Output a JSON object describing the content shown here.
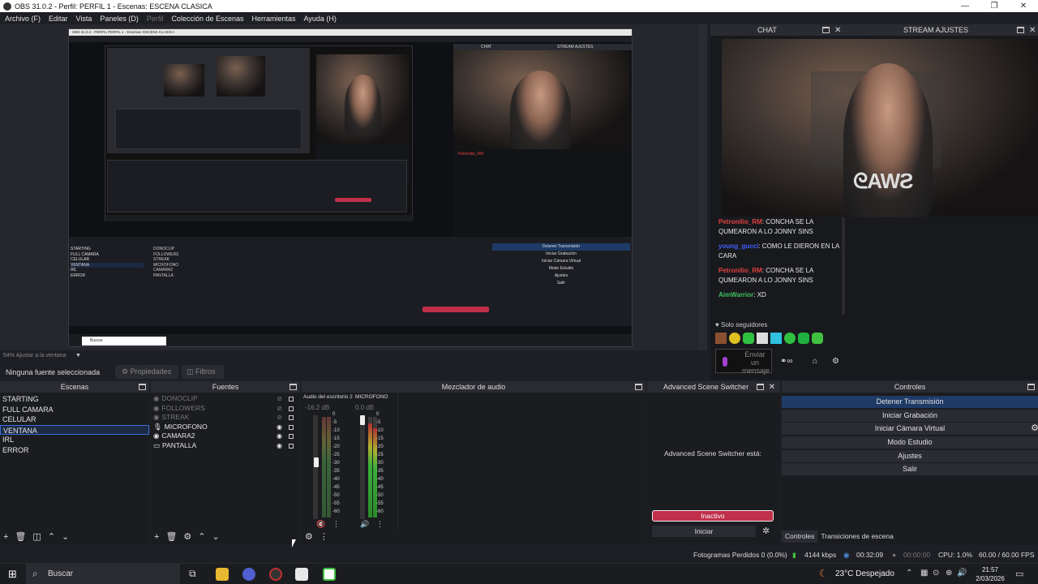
{
  "window": {
    "title": "OBS 31.0.2 - Perfil: PERFIL 1 - Escenas: ESCENA CLASICA",
    "controls": [
      "—",
      "❐",
      "✕"
    ]
  },
  "menu": [
    {
      "label": "Archivo (F)"
    },
    {
      "label": "Editar"
    },
    {
      "label": "Vista"
    },
    {
      "label": "Paneles (D)"
    },
    {
      "label": "Perfil",
      "disabled": true
    },
    {
      "label": "Colección de Escenas"
    },
    {
      "label": "Herramientas"
    },
    {
      "label": "Ayuda (H)"
    }
  ],
  "preview": {
    "zoom_label": "54% Ajustar a la ventana"
  },
  "nested_preview": {
    "title": "OBS 31.0.2 - PERFIL PERFIL 1 - Escenas: ESCENA CLASICA",
    "chat_label": "CHAT",
    "stream_label": "STREAM AJUSTES",
    "scenes": [
      "STARTING",
      "FULL CAMARA",
      "CELULAR",
      "VENTANA",
      "IRL",
      "ERROR"
    ],
    "sources": [
      "DONOCLIP",
      "FOLLOWERS",
      "STREAK",
      "MICROFONO",
      "CAMARA2",
      "PANTALLA"
    ],
    "controls": [
      "Detener Transmisión",
      "Iniciar Grabación",
      "Iniciar Cámara Virtual",
      "Modo Estudio",
      "Ajustes",
      "Salir"
    ],
    "search_label": "Buscar"
  },
  "chat_dock": {
    "header_chat": "CHAT",
    "header_stream": "STREAM AJUSTES",
    "messages": [
      {
        "user": "Petronilio_RM",
        "text": "CONCHA SE LA QUMEARON A LO JONNY SINS",
        "color": "#e04040"
      },
      {
        "user": "young_gucci",
        "text": "COMO LE DIERON EN LA CARA",
        "color": "#4060ff"
      },
      {
        "user": "Petronilio_RM",
        "text": "CONCHA SE LA QUMEARON A LO JONNY SINS",
        "color": "#e04040"
      },
      {
        "user": "AimWarrior",
        "text": "XD",
        "color": "#40c060"
      }
    ],
    "followers_only": "Solo seguidores",
    "send_placeholder": "Enviar un mensaje"
  },
  "source_toolbar": {
    "none_selected": "Ninguna fuente seleccionada",
    "properties": "Propiedades",
    "filters": "Filtros"
  },
  "scenes": {
    "title": "Escenas",
    "items": [
      {
        "label": "STARTING"
      },
      {
        "label": "FULL CAMARA"
      },
      {
        "label": "CELULAR"
      },
      {
        "label": "VENTANA",
        "selected": true
      },
      {
        "label": "IRL"
      },
      {
        "label": "ERROR"
      }
    ]
  },
  "sources": {
    "title": "Fuentes",
    "items": [
      {
        "label": "DONOCLIP",
        "visible": false
      },
      {
        "label": "FOLLOWERS",
        "visible": false
      },
      {
        "label": "STREAK",
        "visible": false
      },
      {
        "label": "MICROFONO",
        "visible": true
      },
      {
        "label": "CAMARA2",
        "visible": true
      },
      {
        "label": "PANTALLA",
        "visible": true
      }
    ]
  },
  "mixer": {
    "title": "Mezclador de audio",
    "channels": [
      {
        "name": "Audio del escritorio 2",
        "db": "-16.2 dB",
        "level": 0.45,
        "muted": true
      },
      {
        "name": "MICROFONO",
        "db": "0.0 dB",
        "level": 0.92,
        "muted": false
      }
    ],
    "ticks": [
      "0",
      "-5",
      "-10",
      "-15",
      "-20",
      "-25",
      "-30",
      "-35",
      "-40",
      "-45",
      "-50",
      "-55",
      "-60"
    ]
  },
  "switcher": {
    "title": "Advanced Scene Switcher",
    "status_label": "Advanced Scene Switcher está:",
    "state": "Inactivo",
    "start": "Iniciar"
  },
  "controls": {
    "title": "Controles",
    "buttons": [
      "Detener Transmisión",
      "Iniciar Grabación",
      "Iniciar Cámara Virtual",
      "Modo Estudio",
      "Ajustes",
      "Salir"
    ],
    "tabs": [
      "Controles",
      "Transiciones de escena"
    ]
  },
  "statusbar": {
    "dropped": "Fotogramas Perdidos 0 (0.0%)",
    "bitrate": "4144 kbps",
    "stream_time": "00:32:09",
    "rec_time": "00:00:00",
    "cpu": "CPU: 1.0%",
    "fps": "60.00 / 60.00 FPS"
  },
  "taskbar": {
    "search": "Buscar",
    "weather": "23°C  Despejado",
    "time": "21:57",
    "date": "2/03/2026"
  },
  "colors": {
    "accent_blue": "#3a6fd8",
    "stop_red": "#c0304a",
    "bg_dark": "#1e1f24"
  }
}
